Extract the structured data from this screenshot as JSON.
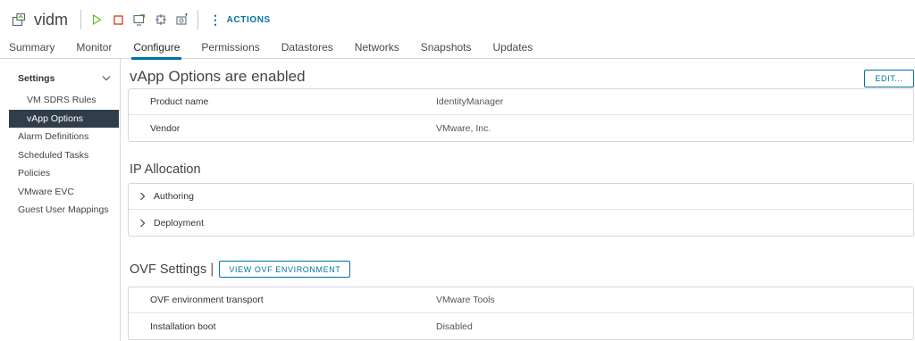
{
  "header": {
    "title": "vidm",
    "icons": [
      "vm-icon",
      "power-on-icon",
      "power-off-icon",
      "console-icon",
      "migrate-icon",
      "snapshot-icon"
    ],
    "actions_label": "ACTIONS",
    "accent_color": "#0072a3",
    "power_on_color": "#5eb715",
    "power_off_color": "#e12200"
  },
  "tabs": [
    {
      "label": "Summary"
    },
    {
      "label": "Monitor"
    },
    {
      "label": "Configure"
    },
    {
      "label": "Permissions"
    },
    {
      "label": "Datastores"
    },
    {
      "label": "Networks"
    },
    {
      "label": "Snapshots"
    },
    {
      "label": "Updates"
    }
  ],
  "active_tab": "Configure",
  "sidebar": {
    "group_label": "Settings",
    "items": [
      {
        "label": "VM SDRS Rules"
      },
      {
        "label": "vApp Options"
      },
      {
        "label": "Alarm Definitions"
      },
      {
        "label": "Scheduled Tasks"
      },
      {
        "label": "Policies"
      },
      {
        "label": "VMware EVC"
      },
      {
        "label": "Guest User Mappings"
      }
    ],
    "selected": "vApp Options",
    "selected_bg": "#313d4a"
  },
  "main": {
    "title": "vApp Options are enabled",
    "edit_label": "EDIT...",
    "product": {
      "rows": [
        {
          "key": "Product name",
          "value": "IdentityManager"
        },
        {
          "key": "Vendor",
          "value": "VMware, Inc."
        }
      ]
    },
    "ip_allocation": {
      "title": "IP Allocation",
      "items": [
        {
          "label": "Authoring"
        },
        {
          "label": "Deployment"
        }
      ]
    },
    "ovf": {
      "title": "OVF Settings",
      "divider": "|",
      "button_label": "VIEW OVF ENVIRONMENT",
      "rows": [
        {
          "key": "OVF environment transport",
          "value": "VMware Tools"
        },
        {
          "key": "Installation boot",
          "value": "Disabled"
        }
      ]
    }
  }
}
